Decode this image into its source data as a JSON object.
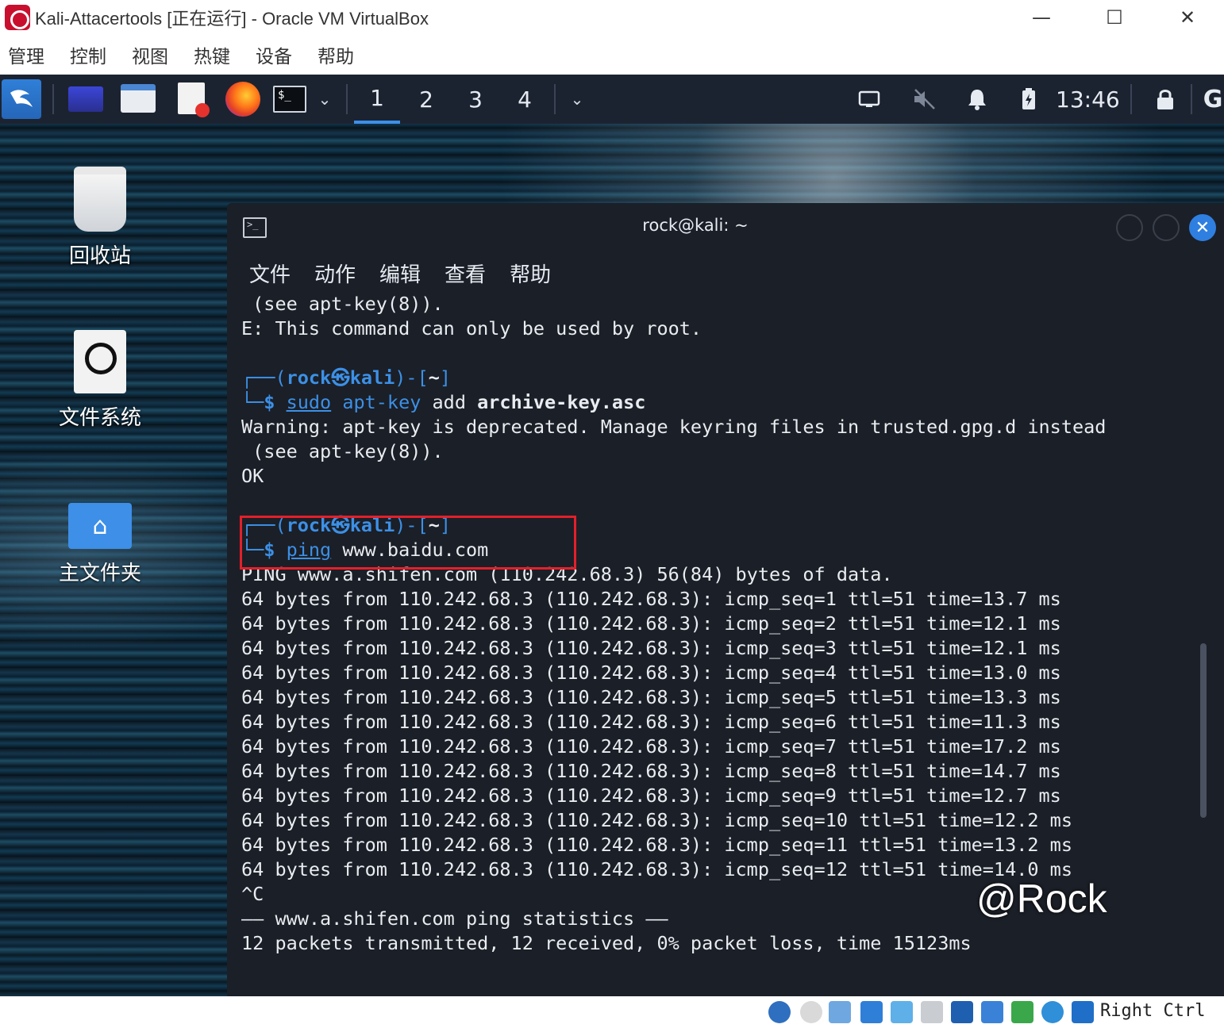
{
  "host": {
    "title": "Kali-Attacertools [正在运行] - Oracle VM VirtualBox",
    "menu": [
      "管理",
      "控制",
      "视图",
      "热键",
      "设备",
      "帮助"
    ],
    "controls": {
      "minimize": "—",
      "maximize": "☐",
      "close": "✕"
    }
  },
  "panel": {
    "workspaces": [
      "1",
      "2",
      "3",
      "4"
    ],
    "active_workspace": "1",
    "clock": "13:46",
    "icons": [
      "kali-menu-icon",
      "desktop-icon",
      "file-manager-icon",
      "text-editor-icon",
      "firefox-icon",
      "terminal-icon",
      "chevron-down-icon",
      "display-icon",
      "volume-muted-icon",
      "bell-icon",
      "battery-icon",
      "lock-icon"
    ]
  },
  "desktop": {
    "icons": [
      {
        "label": "回收站",
        "icon": "trash-icon"
      },
      {
        "label": "文件系统",
        "icon": "drive-icon"
      },
      {
        "label": "主文件夹",
        "icon": "home-folder-icon"
      }
    ]
  },
  "terminal": {
    "title": "rock@kali: ~",
    "menu": [
      "文件",
      "动作",
      "编辑",
      "查看",
      "帮助"
    ],
    "prompt": {
      "user": "rock",
      "at_symbol": "㉿",
      "host": "kali",
      "dir": "~"
    },
    "lines_top": [
      " (see apt-key(8)).",
      "E: This command can only be used by root."
    ],
    "cmd1": {
      "sudo": "sudo",
      "tool": "apt-key",
      "args": " add ",
      "file": "archive-key.asc"
    },
    "cmd1_output": [
      "Warning: apt-key is deprecated. Manage keyring files in trusted.gpg.d instead",
      " (see apt-key(8)).",
      "OK"
    ],
    "cmd2": {
      "tool": "ping",
      "arg": "www.baidu.com"
    },
    "ping_header": "PING www.a.shifen.com (110.242.68.3) 56(84) bytes of data.",
    "ping_replies": [
      "64 bytes from 110.242.68.3 (110.242.68.3): icmp_seq=1 ttl=51 time=13.7 ms",
      "64 bytes from 110.242.68.3 (110.242.68.3): icmp_seq=2 ttl=51 time=12.1 ms",
      "64 bytes from 110.242.68.3 (110.242.68.3): icmp_seq=3 ttl=51 time=12.1 ms",
      "64 bytes from 110.242.68.3 (110.242.68.3): icmp_seq=4 ttl=51 time=13.0 ms",
      "64 bytes from 110.242.68.3 (110.242.68.3): icmp_seq=5 ttl=51 time=13.3 ms",
      "64 bytes from 110.242.68.3 (110.242.68.3): icmp_seq=6 ttl=51 time=11.3 ms",
      "64 bytes from 110.242.68.3 (110.242.68.3): icmp_seq=7 ttl=51 time=17.2 ms",
      "64 bytes from 110.242.68.3 (110.242.68.3): icmp_seq=8 ttl=51 time=14.7 ms",
      "64 bytes from 110.242.68.3 (110.242.68.3): icmp_seq=9 ttl=51 time=12.7 ms",
      "64 bytes from 110.242.68.3 (110.242.68.3): icmp_seq=10 ttl=51 time=12.2 ms",
      "64 bytes from 110.242.68.3 (110.242.68.3): icmp_seq=11 ttl=51 time=13.2 ms",
      "64 bytes from 110.242.68.3 (110.242.68.3): icmp_seq=12 ttl=51 time=14.0 ms"
    ],
    "interrupt": "^C",
    "stats_header": "—— www.a.shifen.com ping statistics ——",
    "stats_summary": "12 packets transmitted, 12 received, 0% packet loss, time 15123ms"
  },
  "watermark": "@Rock",
  "statusbar": {
    "host_key": "Right Ctrl",
    "icons": [
      "hard-disk-icon",
      "optical-drive-icon",
      "audio-icon",
      "network-icon",
      "usb-icon",
      "shared-folders-icon",
      "display-icon",
      "video-capture-icon",
      "cpu-icon",
      "guest-additions-icon",
      "mouse-integration-icon"
    ]
  },
  "colors": {
    "prompt_blue": "#3c90e6",
    "highlight_red": "#e3202a",
    "terminal_bg": "#1b1f27",
    "panel_bg": "#1c2330"
  }
}
